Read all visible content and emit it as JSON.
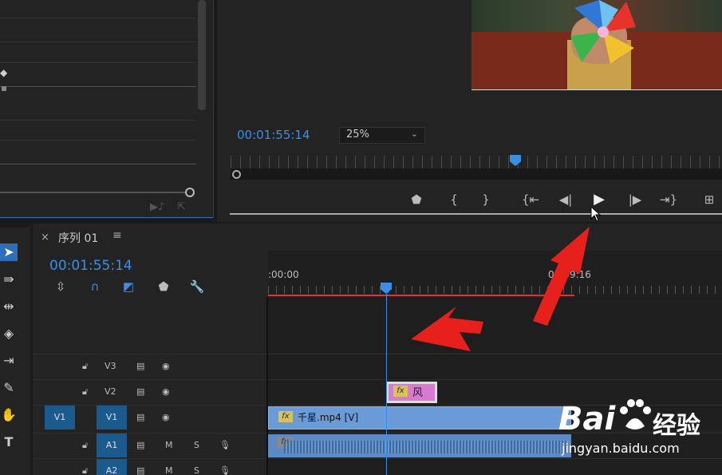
{
  "monitor": {
    "timecode": "00:01:55:14",
    "zoom": "25%"
  },
  "timeline": {
    "title": "序列 01",
    "timecode": "00:01:55:14",
    "ruler_start": ":00:00",
    "ruler_end": "00:59:16",
    "tracks": {
      "v3": "V3",
      "v2": "V2",
      "v1_source": "V1",
      "v1": "V1",
      "a1": "A1",
      "a2": "A2",
      "mute": "M",
      "solo": "S"
    },
    "clips": {
      "v2_label": "风",
      "v1_label": "千星.mp4 [V]",
      "fx": "fx"
    }
  },
  "watermark": {
    "brand": "Bai",
    "brand_cn": "经验",
    "url": "jingyan.baidu.com"
  },
  "colors": {
    "accent_blue": "#3a8ee6",
    "arrow_red": "#e8201c",
    "clip_video": "#6b9bd6",
    "clip_pink": "#d87ad0"
  }
}
